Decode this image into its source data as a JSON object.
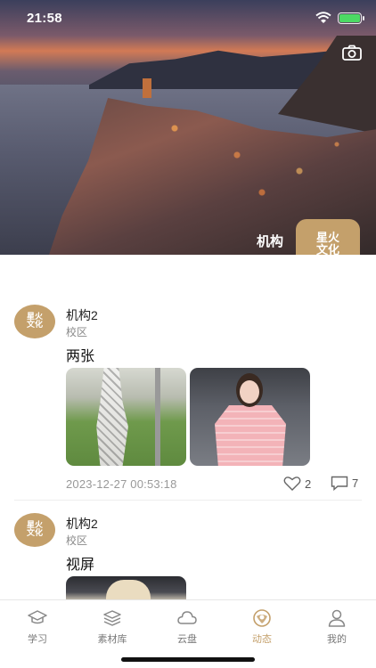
{
  "status_bar": {
    "time": "21:58"
  },
  "header": {
    "org_name": "机构",
    "logo_text_line1": "星火",
    "logo_text_line2": "文化",
    "camera_icon": "camera-icon"
  },
  "posts": [
    {
      "author": "机构2",
      "campus": "校区",
      "text": "两张",
      "timestamp": "2023-12-27 00:53:18",
      "likes": "2",
      "comments": "7",
      "avatar_line1": "星火",
      "avatar_line2": "文化"
    },
    {
      "author": "机构2",
      "campus": "校区",
      "text": "视屏",
      "avatar_line1": "星火",
      "avatar_line2": "文化"
    }
  ],
  "tabs": [
    {
      "label": "学习",
      "icon": "graduation-cap-icon",
      "active": false
    },
    {
      "label": "素材库",
      "icon": "layers-icon",
      "active": false
    },
    {
      "label": "云盘",
      "icon": "cloud-icon",
      "active": false
    },
    {
      "label": "动态",
      "icon": "feed-icon",
      "active": true
    },
    {
      "label": "我的",
      "icon": "user-icon",
      "active": false
    }
  ],
  "colors": {
    "accent": "#c4a06b",
    "battery": "#4cd964"
  }
}
